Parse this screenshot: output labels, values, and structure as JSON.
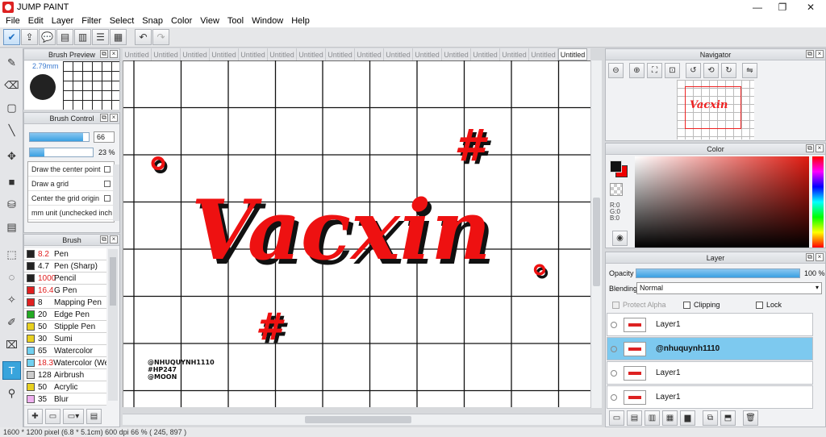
{
  "window": {
    "title": "JUMP PAINT",
    "minimize": "—",
    "maximize": "❐",
    "close": "✕"
  },
  "menu": [
    "File",
    "Edit",
    "Layer",
    "Filter",
    "Select",
    "Snap",
    "Color",
    "View",
    "Tool",
    "Window",
    "Help"
  ],
  "toolbar": {
    "undo": "↶",
    "redo": "↷"
  },
  "brush_preview": {
    "title": "Brush Preview",
    "size": "2.79mm"
  },
  "brush_control": {
    "title": "Brush Control",
    "size_value": "66",
    "size_fill": 0.9,
    "opacity_value": "23 %",
    "opacity_fill": 0.23,
    "options": [
      "Draw the center point",
      "Draw a grid",
      "Center the grid origin",
      "mm unit (unchecked inch"
    ]
  },
  "brush": {
    "title": "Brush",
    "items": [
      {
        "size": "8.2",
        "name": "Pen",
        "color": "#222222",
        "size_red": true
      },
      {
        "size": "4.7",
        "name": "Pen (Sharp)",
        "color": "#222222",
        "size_red": false
      },
      {
        "size": "1000",
        "name": "Pencil",
        "color": "#222222",
        "size_red": true
      },
      {
        "size": "16.4",
        "name": "G Pen",
        "color": "#e02020",
        "size_red": true
      },
      {
        "size": "8",
        "name": "Mapping Pen",
        "color": "#e02020",
        "size_red": false
      },
      {
        "size": "20",
        "name": "Edge Pen",
        "color": "#22aa22",
        "size_red": false
      },
      {
        "size": "50",
        "name": "Stipple Pen",
        "color": "#e8d020",
        "size_red": false
      },
      {
        "size": "30",
        "name": "Sumi",
        "color": "#e8d020",
        "size_red": false
      },
      {
        "size": "65",
        "name": "Watercolor",
        "color": "#70d0f0",
        "size_red": false
      },
      {
        "size": "18.3",
        "name": "Watercolor (We",
        "color": "#70d0f0",
        "size_red": true
      },
      {
        "size": "128",
        "name": "Airbrush",
        "color": "#cccccc",
        "size_red": false
      },
      {
        "size": "50",
        "name": "Acrylic",
        "color": "#e8d020",
        "size_red": false
      },
      {
        "size": "35",
        "name": "Blur",
        "color": "#f0b0f0",
        "size_red": false
      }
    ]
  },
  "tabs": [
    "Untitled",
    "Untitled",
    "Untitled",
    "Untitled",
    "Untitled",
    "Untitled",
    "Untitled",
    "Untitled",
    "Untitled",
    "Untitled",
    "Untitled",
    "Untitled",
    "Untitled",
    "Untitled",
    "Untitled",
    "Untitled"
  ],
  "artwork": {
    "main": "Vacxin",
    "credit_lines": [
      "@NHUQUYNH1110",
      "#HP247",
      "@MOON"
    ],
    "hash": "#",
    "degree": "°"
  },
  "navigator": {
    "title": "Navigator",
    "thumb_text": "Vacxin"
  },
  "color": {
    "title": "Color",
    "r": "R:0",
    "g": "G:0",
    "b": "B:0",
    "primary": "#111111",
    "secondary": "#ee0000"
  },
  "layer": {
    "title": "Layer",
    "opacity_label": "Opacity",
    "opacity_value": "100 %",
    "opacity_fill": 1.0,
    "blending_label": "Blending",
    "blending_value": "Normal",
    "protect_alpha": "Protect Alpha",
    "clipping": "Clipping",
    "lock": "Lock",
    "items": [
      {
        "name": "Layer1",
        "selected": false
      },
      {
        "name": "@nhuquynh1110",
        "selected": true
      },
      {
        "name": "Layer1",
        "selected": false
      },
      {
        "name": "Layer1",
        "selected": false
      }
    ]
  },
  "status": "1600 * 1200 pixel  (6.8 * 5.1cm)  600 dpi  66 %  ( 245, 897 )"
}
